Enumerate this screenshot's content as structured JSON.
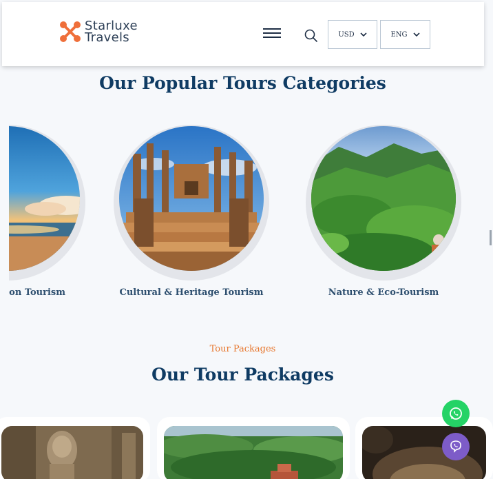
{
  "header": {
    "brand_line1": "Starluxe",
    "brand_line2": "Travels",
    "currency": "USD",
    "language": "ENG"
  },
  "categories": {
    "title": "Our Popular Tours Categories",
    "items": [
      {
        "label": "tion Tourism"
      },
      {
        "label": "Cultural & Heritage Tourism"
      },
      {
        "label": "Nature & Eco-Tourism"
      }
    ]
  },
  "packages": {
    "subtitle": "Tour Packages",
    "title": "Our Tour Packages"
  },
  "colors": {
    "brand_orange": "#ef6f3a",
    "heading_navy": "#0f3b63",
    "accent_orange": "#e7762d",
    "whatsapp_green": "#25d366",
    "viber_purple": "#7d5cc8"
  },
  "icons": [
    "logo-icon",
    "menu-icon",
    "search-icon",
    "chevron-down-icon",
    "whatsapp-icon",
    "viber-icon"
  ]
}
